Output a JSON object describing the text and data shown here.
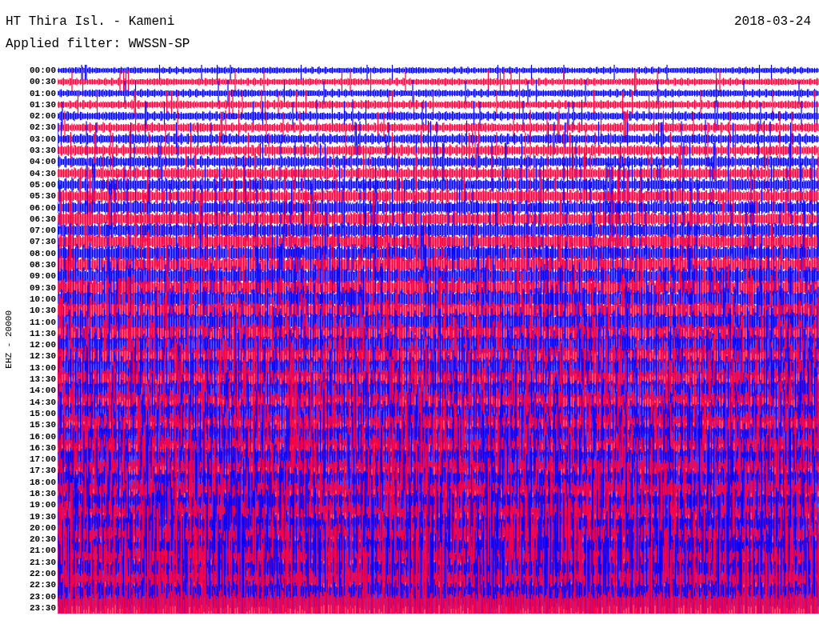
{
  "header": {
    "station": "HT Thira Isl. - Kameni",
    "date": "2018-03-24",
    "filter": "Applied filter: WWSSN-SP"
  },
  "axis_label": "EHZ - 20000",
  "rows": [
    {
      "time": "00:00"
    },
    {
      "time": "00:30"
    },
    {
      "time": "01:00"
    },
    {
      "time": "01:30"
    },
    {
      "time": "02:00"
    },
    {
      "time": "02:30"
    },
    {
      "time": "03:00"
    },
    {
      "time": "03:30"
    },
    {
      "time": "04:00"
    },
    {
      "time": "04:30"
    },
    {
      "time": "05:00"
    },
    {
      "time": "05:30"
    },
    {
      "time": "06:00"
    },
    {
      "time": "06:30"
    },
    {
      "time": "07:00"
    },
    {
      "time": "07:30"
    },
    {
      "time": "08:00"
    },
    {
      "time": "08:30"
    },
    {
      "time": "09:00"
    },
    {
      "time": "09:30"
    },
    {
      "time": "10:00"
    },
    {
      "time": "10:30"
    },
    {
      "time": "11:00"
    },
    {
      "time": "11:30"
    },
    {
      "time": "12:00"
    },
    {
      "time": "12:30"
    },
    {
      "time": "13:00"
    },
    {
      "time": "13:30"
    },
    {
      "time": "14:00"
    },
    {
      "time": "14:30"
    },
    {
      "time": "15:00"
    },
    {
      "time": "15:30"
    },
    {
      "time": "16:00"
    },
    {
      "time": "16:30"
    },
    {
      "time": "17:00"
    },
    {
      "time": "17:30"
    },
    {
      "time": "18:00"
    },
    {
      "time": "18:30"
    },
    {
      "time": "19:00"
    },
    {
      "time": "19:30"
    },
    {
      "time": "20:00"
    },
    {
      "time": "20:30"
    },
    {
      "time": "21:00"
    },
    {
      "time": "21:30"
    },
    {
      "time": "22:00"
    },
    {
      "time": "22:30"
    },
    {
      "time": "23:00"
    },
    {
      "time": "23:30"
    }
  ]
}
